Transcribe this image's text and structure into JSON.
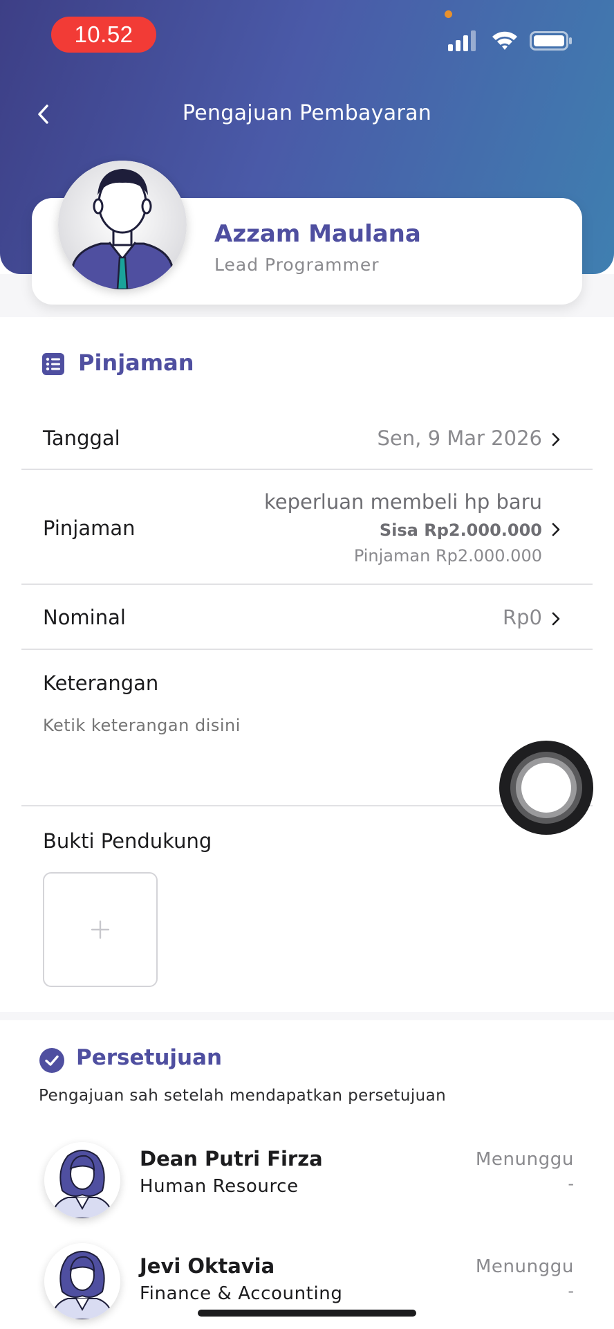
{
  "status_bar": {
    "time": "10.52"
  },
  "nav": {
    "title": "Pengajuan Pembayaran"
  },
  "profile": {
    "name": "Azzam Maulana",
    "role": "Lead Programmer"
  },
  "section": {
    "title": "Pinjaman"
  },
  "rows": {
    "tanggal": {
      "label": "Tanggal",
      "value": "Sen, 9 Mar 2026"
    },
    "pinjaman": {
      "label": "Pinjaman",
      "purpose": "keperluan membeli hp baru",
      "sisa": "Sisa Rp2.000.000",
      "total": "Pinjaman Rp2.000.000"
    },
    "nominal": {
      "label": "Nominal",
      "value": "Rp0"
    },
    "keterangan": {
      "label": "Keterangan",
      "placeholder": "Ketik keterangan disini"
    },
    "bukti": {
      "label": "Bukti Pendukung"
    }
  },
  "approval": {
    "title": "Persetujuan",
    "description": "Pengajuan sah setelah mendapatkan persetujuan",
    "approvers": [
      {
        "name": "Dean Putri Firza",
        "role": "Human Resource",
        "status": "Menunggu",
        "date": "-"
      },
      {
        "name": "Jevi Oktavia",
        "role": "Finance & Accounting",
        "status": "Menunggu",
        "date": "-"
      }
    ]
  },
  "colors": {
    "accent": "#4f4fa0",
    "header_start": "#3d3f86",
    "header_end": "#3f7fb0",
    "time_pill": "#f23b36"
  },
  "icons": [
    "back-icon",
    "signal-icon",
    "wifi-icon",
    "battery-icon",
    "list-icon",
    "chevron-right-icon",
    "plus-icon",
    "check-circle-icon"
  ]
}
